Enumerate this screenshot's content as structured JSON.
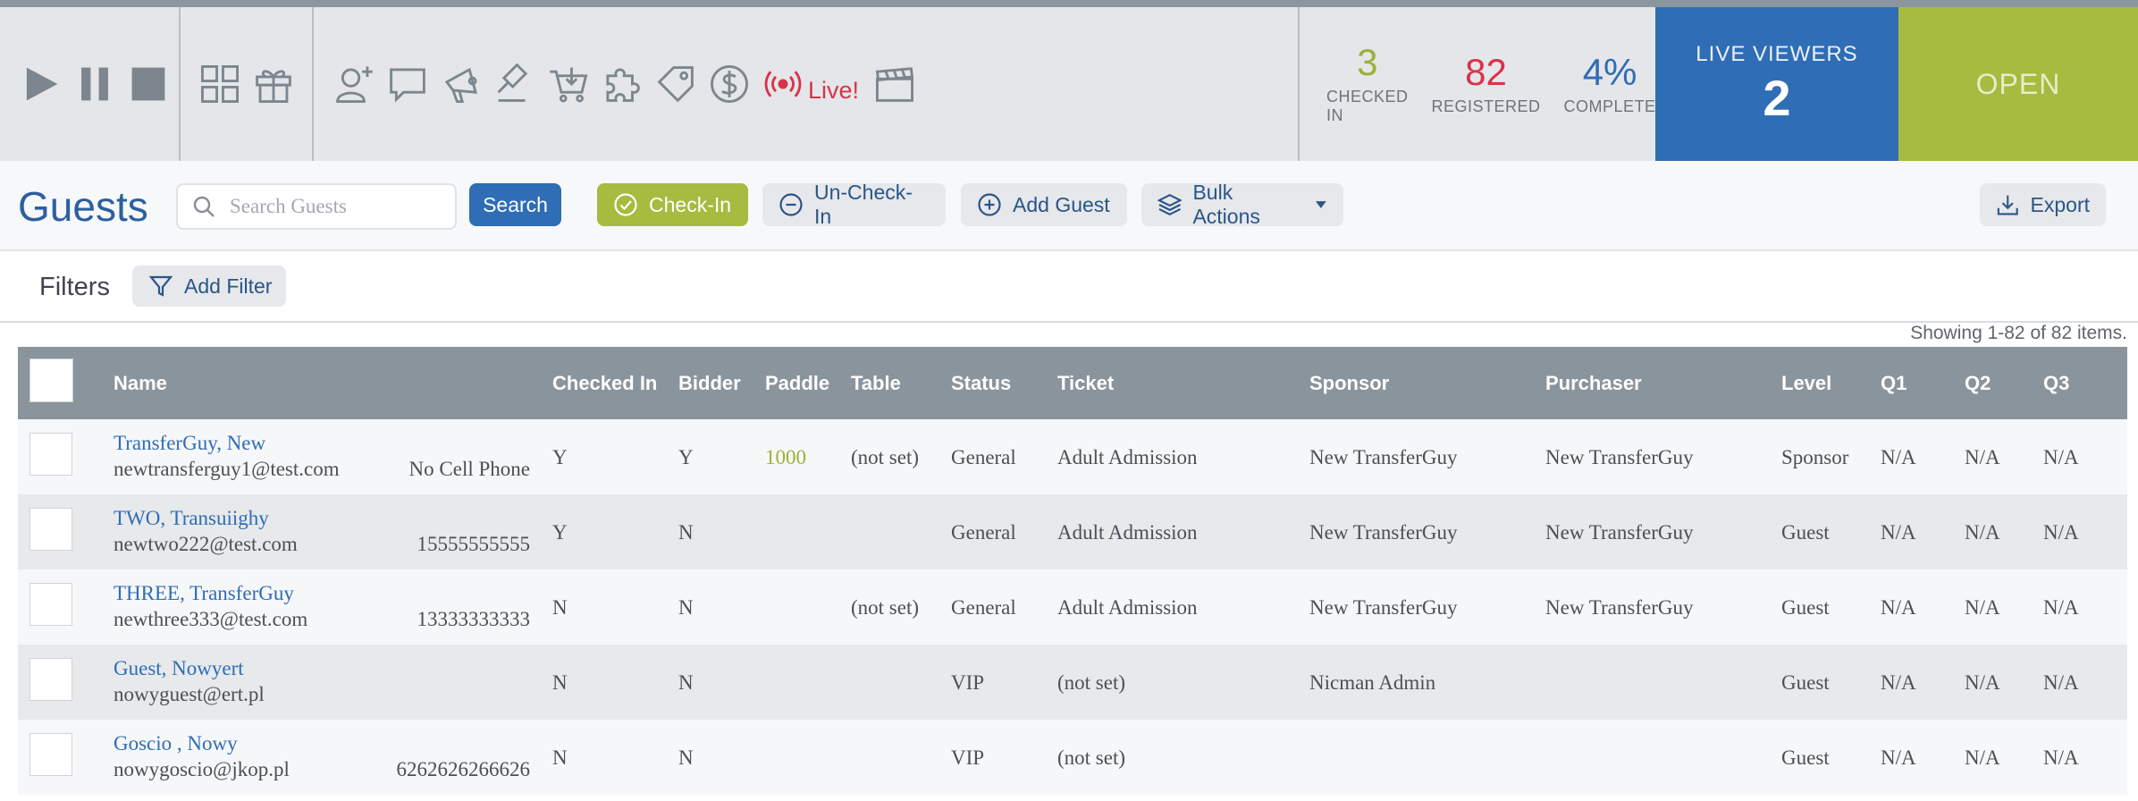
{
  "toolbar": {
    "live_label": "Live!",
    "icons_group1": [
      "play-icon",
      "pause-icon",
      "stop-icon"
    ],
    "icons_group2": [
      "grid-icon",
      "gift-icon"
    ],
    "icons_group3": [
      "add-user-icon",
      "chat-icon",
      "megaphone-icon",
      "gavel-icon",
      "cart-icon",
      "puzzle-icon",
      "tag-icon",
      "dollar-icon",
      "broadcast-icon",
      "clapperboard-icon"
    ]
  },
  "stats": {
    "checked_in": {
      "value": "3",
      "label": "CHECKED IN",
      "color": "#9bb135"
    },
    "registered": {
      "value": "82",
      "label": "REGISTERED",
      "color": "#d8334a"
    },
    "complete": {
      "value": "4%",
      "label": "COMPLETE",
      "color": "#2f6db5"
    }
  },
  "live_viewers": {
    "label": "LIVE VIEWERS",
    "value": "2"
  },
  "status": {
    "label": "OPEN"
  },
  "guests": {
    "title": "Guests",
    "search_placeholder": "Search Guests",
    "search_button": "Search",
    "checkin_button": "Check-In",
    "uncheckin_button": "Un-Check-In",
    "add_guest_button": "Add Guest",
    "bulk_actions_button": "Bulk Actions",
    "export_button": "Export"
  },
  "filters": {
    "label": "Filters",
    "add_filter_button": "Add Filter"
  },
  "table": {
    "showing": "Showing 1-82 of 82 items.",
    "headers": {
      "name": "Name",
      "checked_in": "Checked In",
      "bidder": "Bidder",
      "paddle": "Paddle",
      "table": "Table",
      "status": "Status",
      "ticket": "Ticket",
      "sponsor": "Sponsor",
      "purchaser": "Purchaser",
      "level": "Level",
      "q1": "Q1",
      "q2": "Q2",
      "q3": "Q3"
    },
    "rows": [
      {
        "name": "TransferGuy, New",
        "email": "newtransferguy1@test.com",
        "phone": "No Cell Phone",
        "checked_in": "Y",
        "bidder": "Y",
        "paddle": "1000",
        "table": "(not set)",
        "status": "General",
        "ticket": "Adult Admission",
        "sponsor": "New TransferGuy",
        "purchaser": "New TransferGuy",
        "level": "Sponsor",
        "q1": "N/A",
        "q2": "N/A",
        "q3": "N/A"
      },
      {
        "name": "TWO, Transuiighy",
        "email": "newtwo222@test.com",
        "phone": "15555555555",
        "checked_in": "Y",
        "bidder": "N",
        "paddle": "",
        "table": "",
        "status": "General",
        "ticket": "Adult Admission",
        "sponsor": "New TransferGuy",
        "purchaser": "New TransferGuy",
        "level": "Guest",
        "q1": "N/A",
        "q2": "N/A",
        "q3": "N/A"
      },
      {
        "name": "THREE, TransferGuy",
        "email": "newthree333@test.com",
        "phone": "13333333333",
        "checked_in": "N",
        "bidder": "N",
        "paddle": "",
        "table": "(not set)",
        "status": "General",
        "ticket": "Adult Admission",
        "sponsor": "New TransferGuy",
        "purchaser": "New TransferGuy",
        "level": "Guest",
        "q1": "N/A",
        "q2": "N/A",
        "q3": "N/A"
      },
      {
        "name": "Guest, Nowyert",
        "email": "nowyguest@ert.pl",
        "phone": "",
        "checked_in": "N",
        "bidder": "N",
        "paddle": "",
        "table": "",
        "status": "VIP",
        "ticket": "(not set)",
        "sponsor": "Nicman Admin",
        "purchaser": "",
        "level": "Guest",
        "q1": "N/A",
        "q2": "N/A",
        "q3": "N/A"
      },
      {
        "name": "Goscio , Nowy",
        "email": "nowygoscio@jkop.pl",
        "phone": "6262626266626",
        "checked_in": "N",
        "bidder": "N",
        "paddle": "",
        "table": "",
        "status": "VIP",
        "ticket": "(not set)",
        "sponsor": "",
        "purchaser": "",
        "level": "Guest",
        "q1": "N/A",
        "q2": "N/A",
        "q3": "N/A"
      }
    ]
  }
}
